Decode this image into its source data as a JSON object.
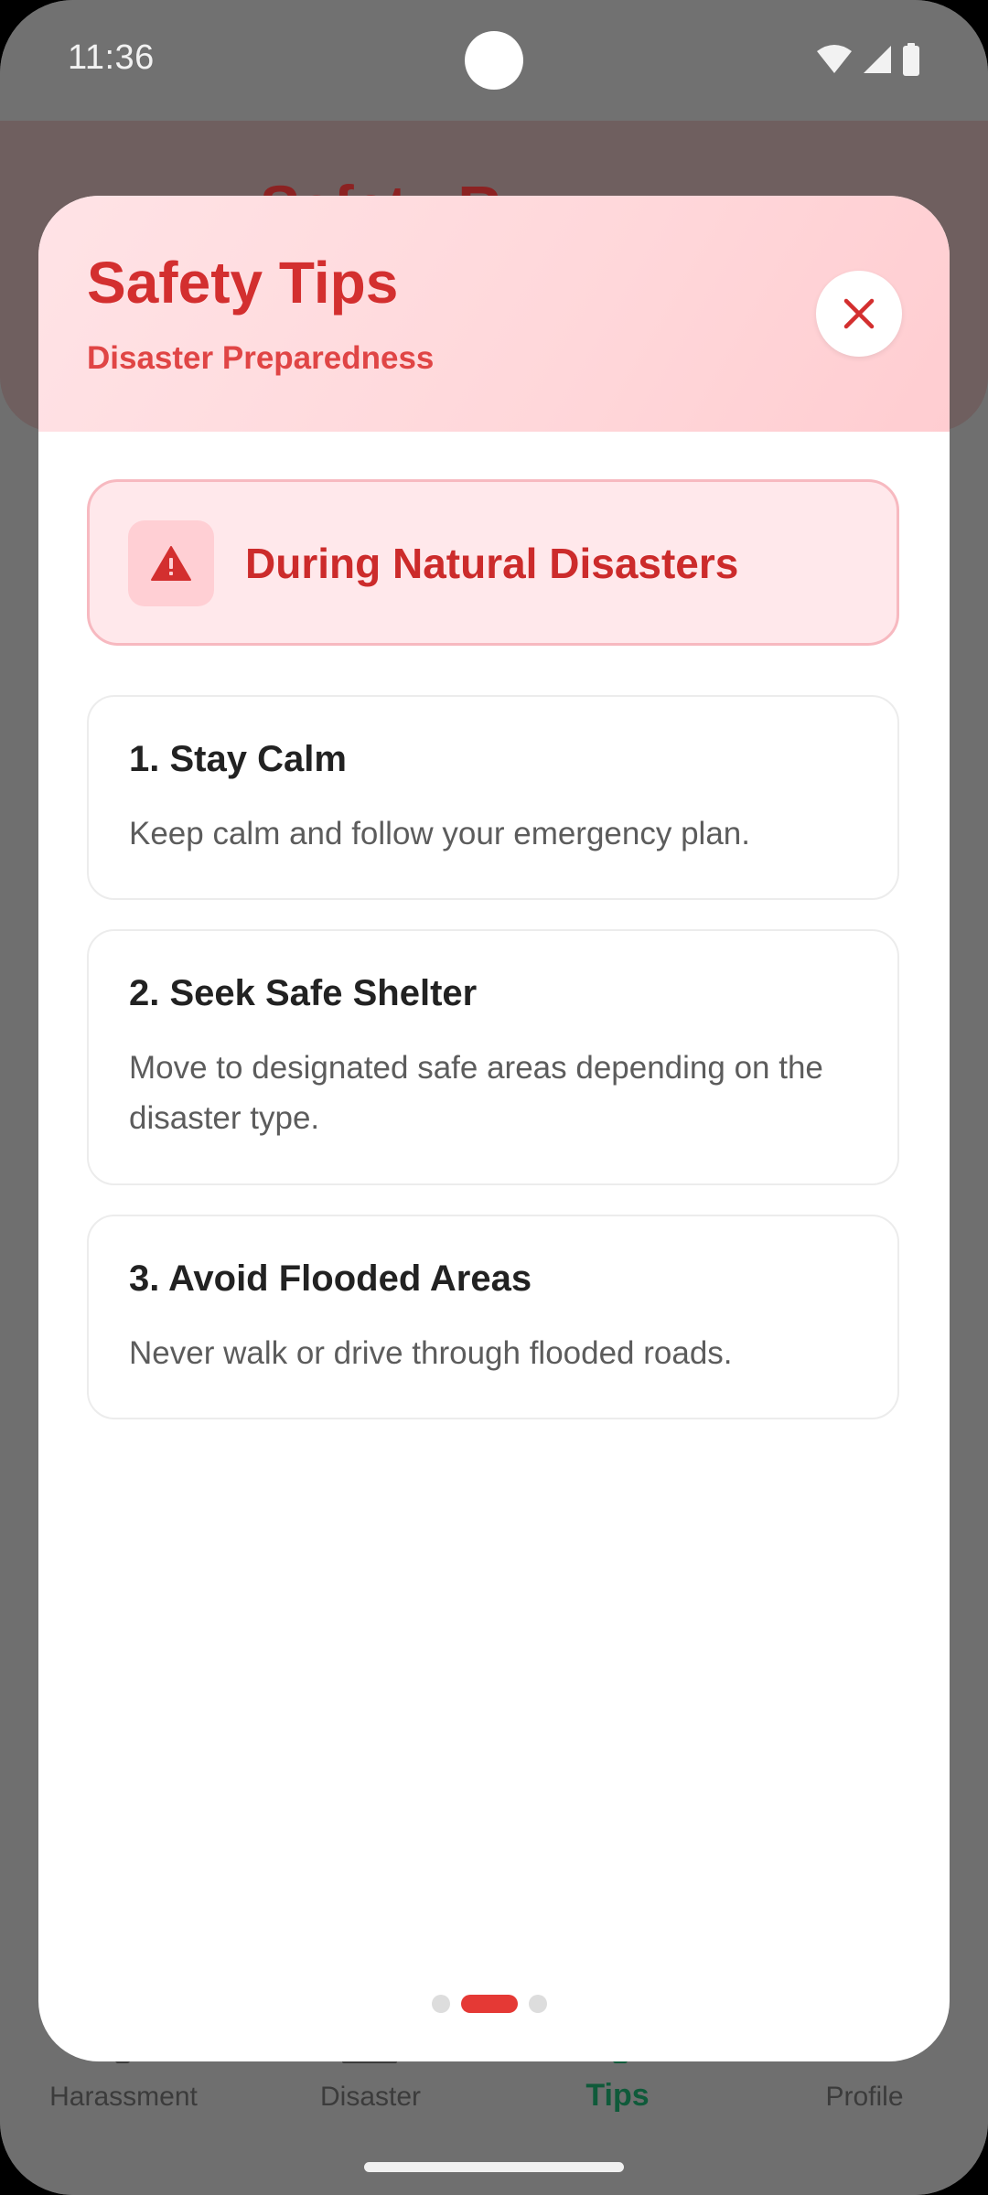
{
  "status_bar": {
    "time": "11:36",
    "icons": [
      "wifi-icon",
      "signal-icon",
      "battery-icon"
    ]
  },
  "background": {
    "title_peek": "Safety R"
  },
  "sheet": {
    "title": "Safety Tips",
    "subtitle": "Disaster Preparedness",
    "close_icon": "close-icon",
    "section": {
      "icon": "warning-icon",
      "title": "During Natural Disasters"
    },
    "tips": [
      {
        "title": "1. Stay Calm",
        "description": "Keep calm and follow your emergency plan."
      },
      {
        "title": "2. Seek Safe Shelter",
        "description": "Move to designated safe areas depending on the disaster type."
      },
      {
        "title": "3. Avoid Flooded Areas",
        "description": "Never walk or drive through flooded roads."
      }
    ],
    "pagination": {
      "total": 3,
      "current": 2
    }
  },
  "bottom_nav": {
    "items": [
      {
        "label": "Harassment",
        "active": false
      },
      {
        "label": "Disaster",
        "active": false
      },
      {
        "label": "Tips",
        "active": true
      },
      {
        "label": "Profile",
        "active": false
      }
    ]
  },
  "colors": {
    "accent": "#d32f2f",
    "nav_active": "#0f5a3a",
    "header_gradient_start": "#ffe3e6",
    "header_gradient_end": "#ffcdd1"
  }
}
